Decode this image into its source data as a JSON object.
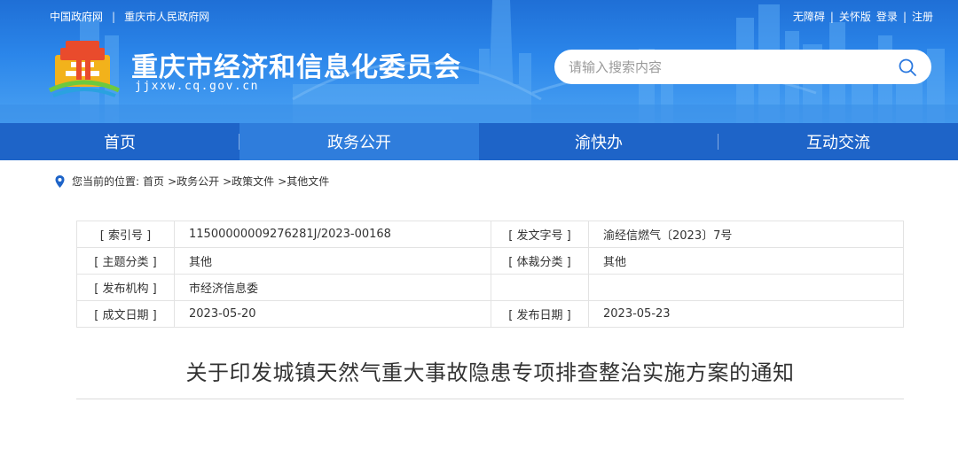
{
  "topbar": {
    "left_links": [
      "中国政府网",
      "重庆市人民政府网"
    ],
    "left_sep": "|",
    "right_items": [
      "无障碍",
      "|",
      "关怀版",
      "登录",
      "|",
      "注册"
    ]
  },
  "site": {
    "title": "重庆市经济和信息化委员会",
    "url": "jjxxw.cq.gov.cn"
  },
  "search": {
    "placeholder": "请输入搜索内容"
  },
  "nav": {
    "items": [
      "首页",
      "政务公开",
      "渝快办",
      "互动交流"
    ],
    "active_index": 1
  },
  "breadcrumb": {
    "prefix": "您当前的位置:",
    "items": [
      "首页",
      ">政务公开",
      ">政策文件",
      ">其他文件"
    ]
  },
  "info": {
    "rows": [
      {
        "l1": "[ 索引号 ]",
        "v1": "11500000009276281J/2023-00168",
        "l2": "[ 发文字号 ]",
        "v2": "渝经信燃气〔2023〕7号"
      },
      {
        "l1": "[ 主题分类 ]",
        "v1": "其他",
        "l2": "[ 体裁分类 ]",
        "v2": "其他"
      },
      {
        "l1": "[ 发布机构 ]",
        "v1": "市经济信息委",
        "l2": "",
        "v2": ""
      },
      {
        "l1": "[ 成文日期 ]",
        "v1": "2023-05-20",
        "l2": "[ 发布日期 ]",
        "v2": "2023-05-23"
      }
    ]
  },
  "article": {
    "title": "关于印发城镇天然气重大事故隐患专项排查整治实施方案的通知"
  },
  "colors": {
    "banner_top": "#1f6fd6",
    "nav_bg": "#1e64c8",
    "nav_active": "#2f7ddc",
    "search_icon": "#2a78df"
  },
  "icons": {
    "logo": "chongqing-city-logo",
    "search": "search-icon",
    "location": "location-pin-icon"
  }
}
